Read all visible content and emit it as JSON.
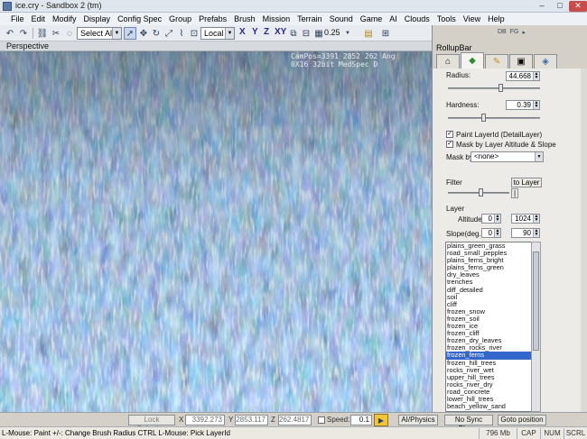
{
  "window": {
    "title": "ice.cry - Sandbox 2 (tm)",
    "min_glyph": "–",
    "max_glyph": "□",
    "close_glyph": "✕"
  },
  "menu": {
    "items": [
      "File",
      "Edit",
      "Modify",
      "Display",
      "Config Spec",
      "Group",
      "Prefabs",
      "Brush",
      "Mission",
      "Terrain",
      "Sound",
      "Game",
      "AI",
      "Clouds",
      "Tools",
      "View",
      "Help"
    ]
  },
  "toolbar": {
    "selection_combo": "Select All",
    "coord_combo": "Local",
    "axis_x": "X",
    "axis_y": "Y",
    "axis_z": "Z",
    "axis_xy": "XY",
    "grid_value": "0.25"
  },
  "viewport": {
    "label": "Perspective",
    "cam_info_line1": "CamPos=3391 2852 262 Ang",
    "cam_info_line2": "0X16 32bit MedSpec D"
  },
  "rollup": {
    "title": "RollupBar",
    "top_icons": [
      "DB",
      "FG",
      "▸"
    ],
    "radius_label": "Radius:",
    "radius_value": "44.668",
    "radius_fraction": 0.58,
    "hardness_label": "Hardness:",
    "hardness_value": "0.39",
    "hardness_fraction": 0.39,
    "paint_layer_label": "Paint LayerId (DetailLayer)",
    "paint_layer_checked": true,
    "mask_altitude_label": "Mask by Layer Altitude & Slope",
    "mask_altitude_checked": true,
    "mask_by_label": "Mask by",
    "mask_by_value": "<none>",
    "filter_label": "Filter",
    "to_layer_button": "to Layer",
    "filter_fraction": 0.55,
    "filter_small_btn": "|",
    "layer_label": "Layer",
    "altitude_label": "Altitude",
    "altitude_min": "0",
    "altitude_max": "1024",
    "slope_label": "Slope(deg.)",
    "slope_min": "0",
    "slope_max": "90",
    "layers": [
      "plains_green_grass",
      "road_small_pepples",
      "plains_ferns_bright",
      "plains_ferns_green",
      "dry_leaves",
      "trenches",
      "diff_detailed",
      "soil",
      "cliff",
      "frozen_snow",
      "frozen_soil",
      "frozen_ice",
      "frozen_cliff",
      "frozen_dry_leaves",
      "frozen_rocks_river",
      "frozen_ferns",
      "frozen_hill_trees",
      "rocks_river_wet",
      "upper_hill_trees",
      "rocks_river_dry",
      "road_concrete",
      "lower_hill_trees",
      "beach_yellow_sand"
    ],
    "selected_layer": "frozen_ferns"
  },
  "bottom": {
    "lock_selection": "Lock Selection",
    "x_label": "X",
    "x_value": "3392.273",
    "y_label": "Y",
    "y_value": "2853.117",
    "z_label": "Z",
    "z_value": "262.4817",
    "speed_label": "Speed:",
    "speed_value": "0.1",
    "ai_physics": "AI/Physics",
    "no_sync": "No Sync Player",
    "goto_position": "Goto position"
  },
  "status": {
    "message": "L-Mouse: Paint  +/-: Change Brush Radius   CTRL L-Mouse: Pick LayerId",
    "memory": "796 Mb",
    "cap": "CAP",
    "num": "NUM",
    "scrl": "SCRL"
  },
  "colors": {
    "selection": "#3367cc",
    "grass_dark": "#1e2a33",
    "grass_light": "#9fb4c4",
    "close_red": "#c94c4c"
  }
}
